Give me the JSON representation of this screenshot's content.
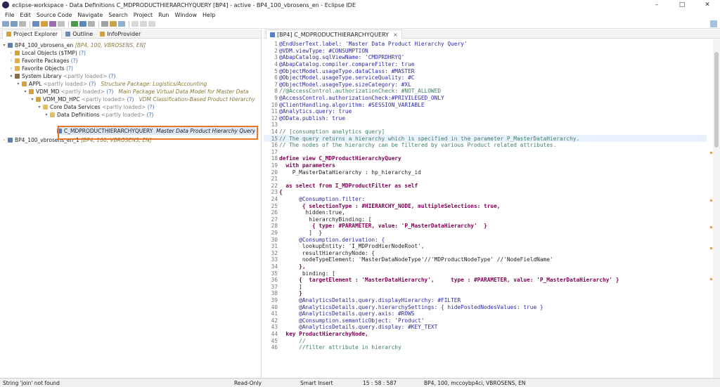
{
  "window": {
    "title": "eclipse-workspace - Data Definitions C_MDPRODUCTHIERARCHYQUERY [BP4] - active - BP4_100_vbrosens_en - Eclipse IDE",
    "minimize": "–",
    "maximize": "□",
    "close": "✕"
  },
  "menu": [
    "File",
    "Edit",
    "Source Code",
    "Navigate",
    "Search",
    "Project",
    "Run",
    "Window",
    "Help"
  ],
  "left_tabs": [
    "Project Explorer",
    "Outline",
    "InfoProvider"
  ],
  "tree": [
    {
      "label": "BP4_100_vbrosens_en",
      "detail": "[BP4, 100, VBROSENS, EN]"
    },
    {
      "label": "Local Objects ($TMP)",
      "detail": "(?)"
    },
    {
      "label": "Favorite Packages",
      "detail": "(?)"
    },
    {
      "label": "Favorite Objects",
      "detail": "(?)"
    },
    {
      "label": "System Library",
      "detail": "<partly loaded>",
      "extra": "(?)"
    },
    {
      "label": "APPL",
      "detail": "<partly loaded>",
      "extra": "(?)",
      "desc": "Structure Package: Logistics/Accounting"
    },
    {
      "label": "VDM_MD",
      "detail": "<partly loaded>",
      "extra": "(?)",
      "desc": "Main Package Virtual Data Model for Master Data"
    },
    {
      "label": "VDM_MD_HPC",
      "detail": "<partly loaded>",
      "extra": "(?)",
      "desc": "VDM Classification-Based Product Hierarchy"
    },
    {
      "label": "Core Data Services",
      "detail": "<partly loaded>",
      "extra": "(?)"
    },
    {
      "label": "Data Definitions",
      "detail": "<partly loaded>",
      "extra": "(?)"
    },
    {
      "label": "C_MDPRODUCTHIERARCHYQUERY",
      "desc": "Master Data Product Hierarchy Query"
    },
    {
      "label": "BP4_100_vbrosens_en_1",
      "detail": "[BP4, 100, VBROSENS, EN]"
    }
  ],
  "editor_tab": "[BP4] C_MDPRODUCTHIERARCHYQUERY",
  "code_lines": [
    {
      "n": "1",
      "t": "@EndUserText.label: 'Master Data Product Hierarchy Query'"
    },
    {
      "n": "2",
      "t": "@VDM.viewType: #CONSUMPTION"
    },
    {
      "n": "3",
      "t": "@AbapCatalog.sqlViewName: 'CMDPRDHRYQ'"
    },
    {
      "n": "4",
      "t": "@AbapCatalog.compiler.compareFilter: true"
    },
    {
      "n": "5",
      "t": "@ObjectModel.usageType.dataClass: #MASTER"
    },
    {
      "n": "6",
      "t": "@ObjectModel.usageType.serviceQuality: #C"
    },
    {
      "n": "7",
      "t": "@ObjectModel.usageType.sizeCategory: #XL"
    },
    {
      "n": "8",
      "t": "//@AccessControl.authorizationCheck: #NOT_ALLOWED"
    },
    {
      "n": "9",
      "t": "@AccessControl.authorizationCheck:#PRIVILEGED_ONLY"
    },
    {
      "n": "10",
      "t": "@ClientHandling.algorithm: #SESSION_VARIABLE"
    },
    {
      "n": "11",
      "t": "@Analytics.query: true"
    },
    {
      "n": "12",
      "t": "@OData.publish: true"
    },
    {
      "n": "13",
      "t": ""
    },
    {
      "n": "14",
      "t": "// [consumption analytics query]"
    },
    {
      "n": "15",
      "t": "// The query returns a hierarchy which is specified in the parameter P_MasterDataHierarchy."
    },
    {
      "n": "16",
      "t": "// The nodes of the hierarchy can be filtered by various Product related attributes."
    },
    {
      "n": "17",
      "t": ""
    },
    {
      "n": "18",
      "t": "define view C_MDProductHierarchyQuery"
    },
    {
      "n": "19",
      "t": "  with parameters"
    },
    {
      "n": "20",
      "t": "    P_MasterDataHierarchy : hp_hierarchy_id"
    },
    {
      "n": "21",
      "t": ""
    },
    {
      "n": "22",
      "t": "  as select from I_MDProductFilter as self"
    },
    {
      "n": "23",
      "t": "{"
    },
    {
      "n": "24",
      "t": "      @Consumption.filter:"
    },
    {
      "n": "25",
      "t": "       { selectionType : #HIERARCHY_NODE, multipleSelections: true,"
    },
    {
      "n": "26",
      "t": "        hidden:true,"
    },
    {
      "n": "27",
      "t": "         hierarchyBinding: ["
    },
    {
      "n": "28",
      "t": "          { type: #PARAMETER, value: 'P_MasterDataHierarchy'  }"
    },
    {
      "n": "29",
      "t": "         ]  }"
    },
    {
      "n": "30",
      "t": "      @Consumption.derivation: {"
    },
    {
      "n": "31",
      "t": "       lookupEntity: 'I_MDProdHierNodeRoot',"
    },
    {
      "n": "32",
      "t": "       resultHierarchyNode: {"
    },
    {
      "n": "33",
      "t": "       nodeTypeElement: 'MasterDataNodeType'//'MDProductNodeType' //'NodeFieldName'"
    },
    {
      "n": "34",
      "t": "      },"
    },
    {
      "n": "35",
      "t": "       binding: ["
    },
    {
      "n": "36",
      "t": "      {  targetElement : 'MasterDataHierarchy',     type : #PARAMETER, value: 'P_MasterDataHierarchy' }"
    },
    {
      "n": "37",
      "t": "      ]"
    },
    {
      "n": "38",
      "t": "      }"
    },
    {
      "n": "39",
      "t": "      @AnalyticsDetails.query.displayHierarchy: #FILTER"
    },
    {
      "n": "40",
      "t": "      @AnalyticsDetails.query.hierarchySettings: { hidePostedNodesValues: true }"
    },
    {
      "n": "41",
      "t": "      @AnalyticsDetails.query.axis: #ROWS"
    },
    {
      "n": "42",
      "t": "      @Consumption.semanticObject: 'Product'"
    },
    {
      "n": "43",
      "t": "      @AnalyticsDetails.query.display: #KEY_TEXT"
    },
    {
      "n": "44",
      "t": "  key ProductHierarchyNode,"
    },
    {
      "n": "45",
      "t": "      //"
    },
    {
      "n": "46",
      "t": "      //filter attribute in hierarchy"
    }
  ],
  "status": {
    "message": "String 'join' not found",
    "mode": "Read-Only",
    "insert": "Smart Insert",
    "position": "15 : 58 : 587",
    "system": "BP4, 100, mccoybp4ci, VBROSENS, EN"
  }
}
